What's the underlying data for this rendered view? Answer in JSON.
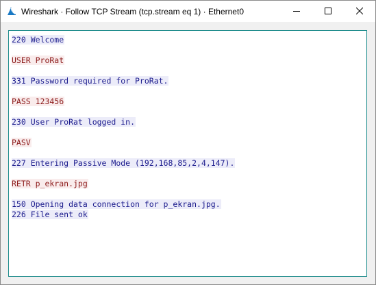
{
  "window": {
    "title": "Wireshark · Follow TCP Stream (tcp.stream eq 1) · Ethernet0"
  },
  "colors": {
    "server_text": "#1a1a8c",
    "server_bg": "#ececf9",
    "client_text": "#8c1a1a",
    "client_bg": "#f9ecec",
    "pane_border": "#1e8c8c",
    "app_icon": "#1979c4"
  },
  "stream": {
    "lines": [
      {
        "dir": "server",
        "text": "220 Welcome"
      },
      {
        "dir": "blank",
        "text": ""
      },
      {
        "dir": "client",
        "text": "USER ProRat"
      },
      {
        "dir": "blank",
        "text": ""
      },
      {
        "dir": "server",
        "text": "331 Password required for ProRat."
      },
      {
        "dir": "blank",
        "text": ""
      },
      {
        "dir": "client",
        "text": "PASS 123456"
      },
      {
        "dir": "blank",
        "text": ""
      },
      {
        "dir": "server",
        "text": "230 User ProRat logged in."
      },
      {
        "dir": "blank",
        "text": ""
      },
      {
        "dir": "client",
        "text": "PASV"
      },
      {
        "dir": "blank",
        "text": ""
      },
      {
        "dir": "server",
        "text": "227 Entering Passive Mode (192,168,85,2,4,147)."
      },
      {
        "dir": "blank",
        "text": ""
      },
      {
        "dir": "client",
        "text": "RETR p_ekran.jpg"
      },
      {
        "dir": "blank",
        "text": ""
      },
      {
        "dir": "server",
        "text": "150 Opening data connection for p_ekran.jpg."
      },
      {
        "dir": "server",
        "text": "226 File sent ok"
      }
    ]
  }
}
